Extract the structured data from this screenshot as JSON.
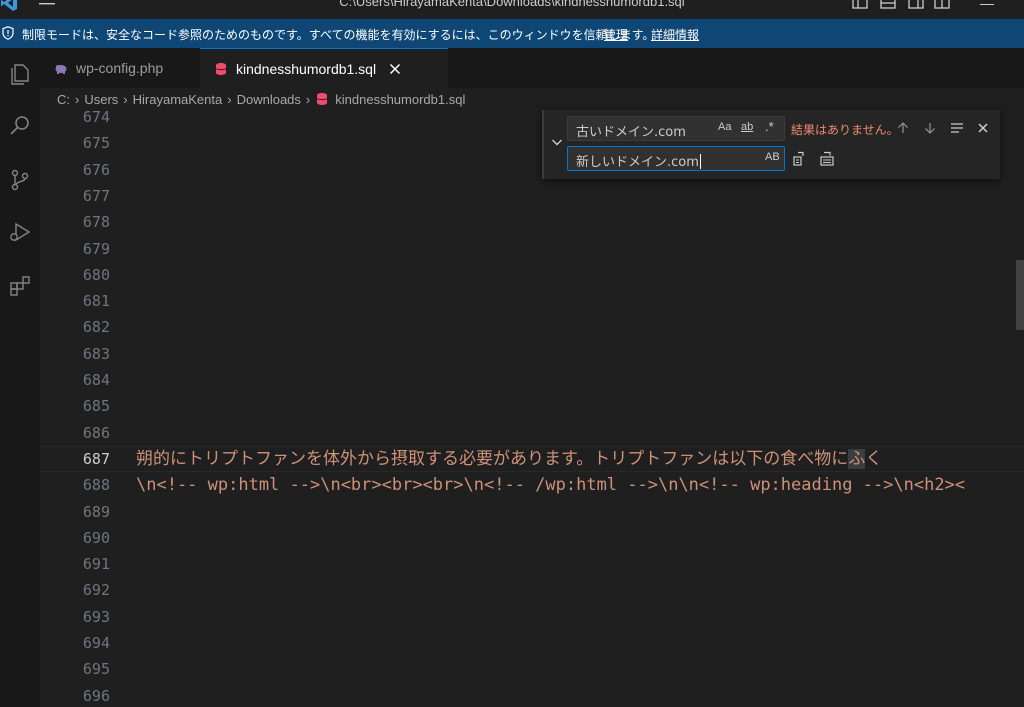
{
  "window": {
    "title": "C:\\Users\\HirayamaKenta\\Downloads\\kindnesshumordb1.sql"
  },
  "banner": {
    "message": "制限モードは、安全なコード参照のためのものです。すべての機能を有効にするには、このウィンドウを信頼します。",
    "manage_link": "管理",
    "details_link": "詳細情報"
  },
  "tabs": [
    {
      "label": "wp-config.php",
      "icon": "php-icon"
    },
    {
      "label": "kindnesshumordb1.sql",
      "icon": "database-icon",
      "active": true
    }
  ],
  "breadcrumb": {
    "parts": [
      "C:",
      "Users",
      "HirayamaKenta",
      "Downloads",
      "kindnesshumordb1.sql"
    ]
  },
  "editor": {
    "line_numbers": [
      "674",
      "675",
      "676",
      "677",
      "678",
      "679",
      "680",
      "681",
      "682",
      "683",
      "684",
      "685",
      "686",
      "687",
      "688",
      "689",
      "690",
      "691",
      "692",
      "693",
      "694",
      "695",
      "696"
    ],
    "active_line": "687",
    "line_687_text": "朔的にトリプトファンを体外から摂取する必要があります。トリプトファンは以下の食べ物に",
    "line_687_highlight": "ふ",
    "line_687_tail": "く",
    "line_688_text": "\\n<!-- wp:html -->\\n<br><br><br>\\n<!-- /wp:html -->\\n\\n<!-- wp:heading -->\\n<h2><"
  },
  "find_widget": {
    "find_value": "古いドメイン.com",
    "replace_value": "新しいドメイン.com",
    "match_case_label": "Aa",
    "whole_word_label": "ab",
    "regex_label": ".*",
    "preserve_case_label": "AB",
    "result_text": "結果はありません。"
  },
  "colors": {
    "banner_bg": "#0e4775",
    "accent": "#0078d4",
    "string": "#ce9178",
    "no_result": "#f48771"
  }
}
